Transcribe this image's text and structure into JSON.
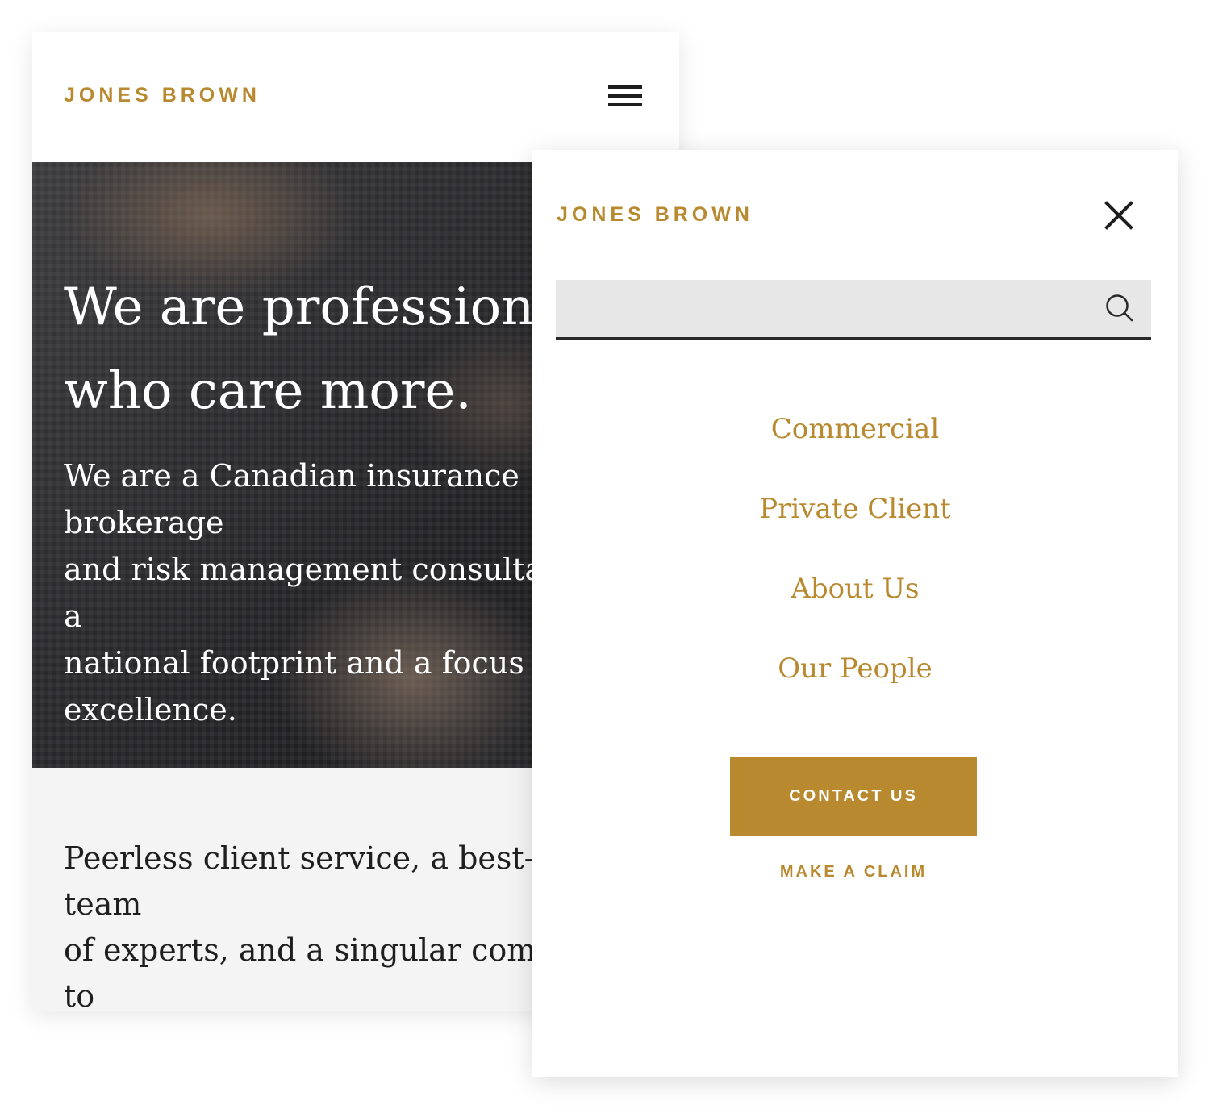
{
  "brand": {
    "name": "JONES BROWN",
    "accent_color": "#b8892e"
  },
  "home": {
    "header": {
      "menu_icon": "hamburger-menu-icon"
    },
    "hero": {
      "title": "We are professionals\nwho care more.",
      "text": "We are a Canadian insurance brokerage\nand risk management consultancy with a\nnational footprint and a focus on\nexcellence."
    },
    "intro": {
      "text": "Peerless client service, a best-in-class team\nof experts, and a singular commitment to\nproviding innovative, tailored solutions."
    }
  },
  "menu": {
    "close_icon": "close-icon",
    "search": {
      "value": "",
      "placeholder": "",
      "icon": "search-icon"
    },
    "nav_items": [
      {
        "label": "Commercial"
      },
      {
        "label": "Private Client"
      },
      {
        "label": "About Us"
      },
      {
        "label": "Our People"
      }
    ],
    "contact_button": "CONTACT US",
    "claim_link": "MAKE A CLAIM"
  }
}
